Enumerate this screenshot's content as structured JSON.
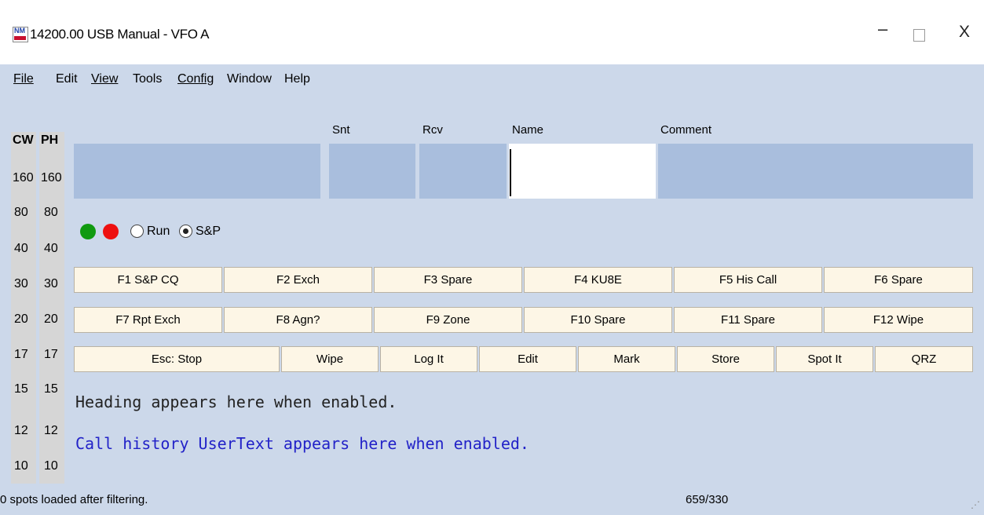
{
  "window": {
    "title": "14200.00 USB Manual - VFO A",
    "icon": "n1mm-logo-icon",
    "minimize": "–",
    "maximize": "",
    "close": "X"
  },
  "menu": [
    "File",
    "Edit",
    "View",
    "Tools",
    "Config",
    "Window",
    "Help"
  ],
  "bands": {
    "cw_header": "CW",
    "ph_header": "PH",
    "cw": [
      "160",
      "80",
      "40",
      "30",
      "20",
      "17",
      "15",
      "12",
      "10"
    ],
    "ph": [
      "160",
      "80",
      "40",
      "30",
      "20",
      "17",
      "15",
      "12",
      "10"
    ]
  },
  "entry": {
    "labels": {
      "snt": "Snt",
      "rcv": "Rcv",
      "name": "Name",
      "comment": "Comment"
    },
    "values": {
      "call": "",
      "snt": "",
      "rcv": "",
      "name": "",
      "comment": ""
    }
  },
  "mode": {
    "run_label": "Run",
    "sp_label": "S&P",
    "selected": "S&P",
    "indicator_green": "#109a10",
    "indicator_red": "#ee1010"
  },
  "fkeys_row1": [
    "F1 S&P CQ",
    "F2 Exch",
    "F3 Spare",
    "F4 KU8E",
    "F5 His Call",
    "F6 Spare"
  ],
  "fkeys_row2": [
    "F7 Rpt Exch",
    "F8 Agn?",
    "F9 Zone",
    "F10 Spare",
    "F11 Spare",
    "F12 Wipe"
  ],
  "actions": {
    "esc": "Esc: Stop",
    "wipe": "Wipe",
    "logit": "Log It",
    "edit": "Edit",
    "mark": "Mark",
    "store": "Store",
    "spotit": "Spot It",
    "qrz": "QRZ"
  },
  "info": {
    "heading": "Heading appears here when enabled.",
    "user_text": "Call history UserText appears here when enabled."
  },
  "status": {
    "left": "0 spots loaded after filtering.",
    "right": "659/330"
  }
}
